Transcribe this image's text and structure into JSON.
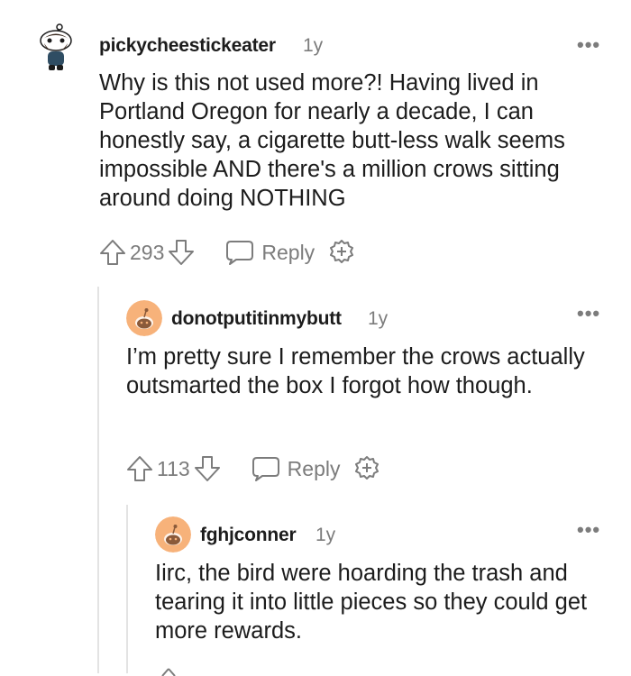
{
  "comments": [
    {
      "author": "pickycheestickeater",
      "age": "1y",
      "more": "•••",
      "body": "Why is this not used more?! Having lived in Portland Oregon for nearly a decade, I can honestly say, a cigarette butt-less walk seems impossible AND there's a million crows sitting around doing NOTHING",
      "votes": "293",
      "reply_label": "Reply",
      "avatar_icon": "snoo-bearded-avatar-icon"
    },
    {
      "author": "donotputitinmybutt",
      "age": "1y",
      "more": "•••",
      "body": "I’m pretty sure I remember the crows actually outsmarted the box I forgot how though.",
      "votes": "113",
      "reply_label": "Reply",
      "avatar_icon": "default-snoo-avatar-icon"
    },
    {
      "author": "fghjconner",
      "age": "1y",
      "more": "•••",
      "body": "Iirc, the bird were hoarding the trash and tearing it into little pieces so they could get more rewards.",
      "avatar_icon": "default-snoo-avatar-icon"
    }
  ],
  "colors": {
    "avatar_orange": "#f7b27a",
    "thread_line": "#e3e3e3",
    "meta_gray": "#7c7c7c"
  }
}
